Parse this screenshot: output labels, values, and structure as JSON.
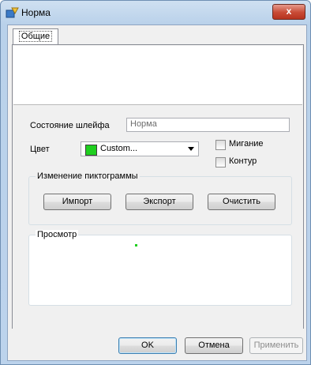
{
  "window": {
    "title": "Норма",
    "close_label": "x"
  },
  "tabs": [
    {
      "label": "Общие"
    }
  ],
  "form": {
    "state_label": "Состояние шлейфа",
    "state_value": "Норма",
    "color_label": "Цвет",
    "color_value": "Custom...",
    "color_swatch": "#1fcf1f",
    "blink_label": "Мигание",
    "outline_label": "Контур"
  },
  "icon_group": {
    "title": "Изменение пиктограммы",
    "import_label": "Импорт",
    "export_label": "Экспорт",
    "clear_label": "Очистить"
  },
  "preview": {
    "title": "Просмотр"
  },
  "footer": {
    "ok_label": "OK",
    "cancel_label": "Отмена",
    "apply_label": "Применить"
  }
}
